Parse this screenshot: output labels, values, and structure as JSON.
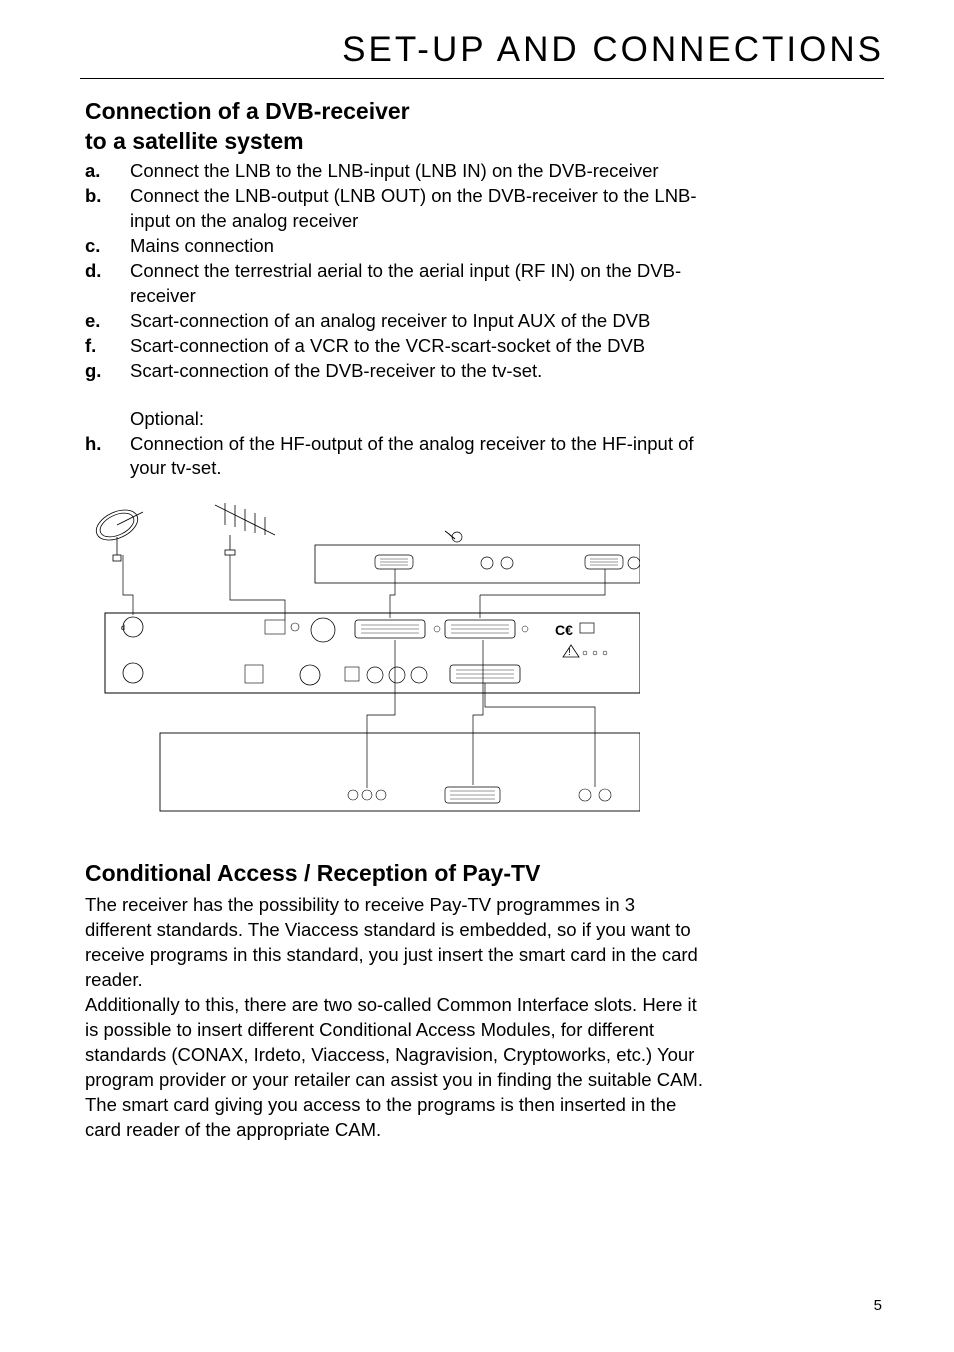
{
  "header": "SET-UP AND CONNECTIONS",
  "section1": {
    "heading_line1": "Connection of a DVB-receiver",
    "heading_line2": "to a satellite system",
    "steps": [
      {
        "letter": "a.",
        "text": "Connect the LNB to the LNB-input (LNB IN) on the DVB-receiver"
      },
      {
        "letter": "b.",
        "text": "Connect the LNB-output (LNB OUT) on the DVB-receiver to the LNB-input on the analog receiver"
      },
      {
        "letter": "c.",
        "text": "Mains connection"
      },
      {
        "letter": "d.",
        "text": "Connect the terrestrial aerial to the aerial input (RF IN) on the DVB-receiver"
      },
      {
        "letter": "e.",
        "text": "Scart-connection of an analog receiver to Input AUX of the DVB"
      },
      {
        "letter": "f.",
        "text": "Scart-connection of a VCR to the VCR-scart-socket of the DVB"
      },
      {
        "letter": "g.",
        "text": "Scart-connection of the DVB-receiver to the tv-set."
      }
    ],
    "optional_label": "Optional:",
    "optional_steps": [
      {
        "letter": "h.",
        "text": "Connection of the HF-output of the analog receiver to the HF-input of your tv-set."
      }
    ]
  },
  "section2": {
    "heading": "Conditional Access / Reception of Pay-TV",
    "para1": "The receiver has the possibility to receive Pay-TV programmes in 3 different standards. The Viaccess standard is embedded, so if you want to receive programs in this standard, you just insert the smart card in the card reader.",
    "para2": "Additionally to this, there are two so-called Common Interface slots. Here it is possible to insert different Conditional Access Modules, for different standards (CONAX, Irdeto, Viaccess, Nagravision, Cryptoworks, etc.) Your program provider or your retailer can assist you in finding the suitable CAM.",
    "para3": "The smart card giving you access to the programs is then inserted in the card reader of the appropriate CAM."
  },
  "page_number": "5"
}
